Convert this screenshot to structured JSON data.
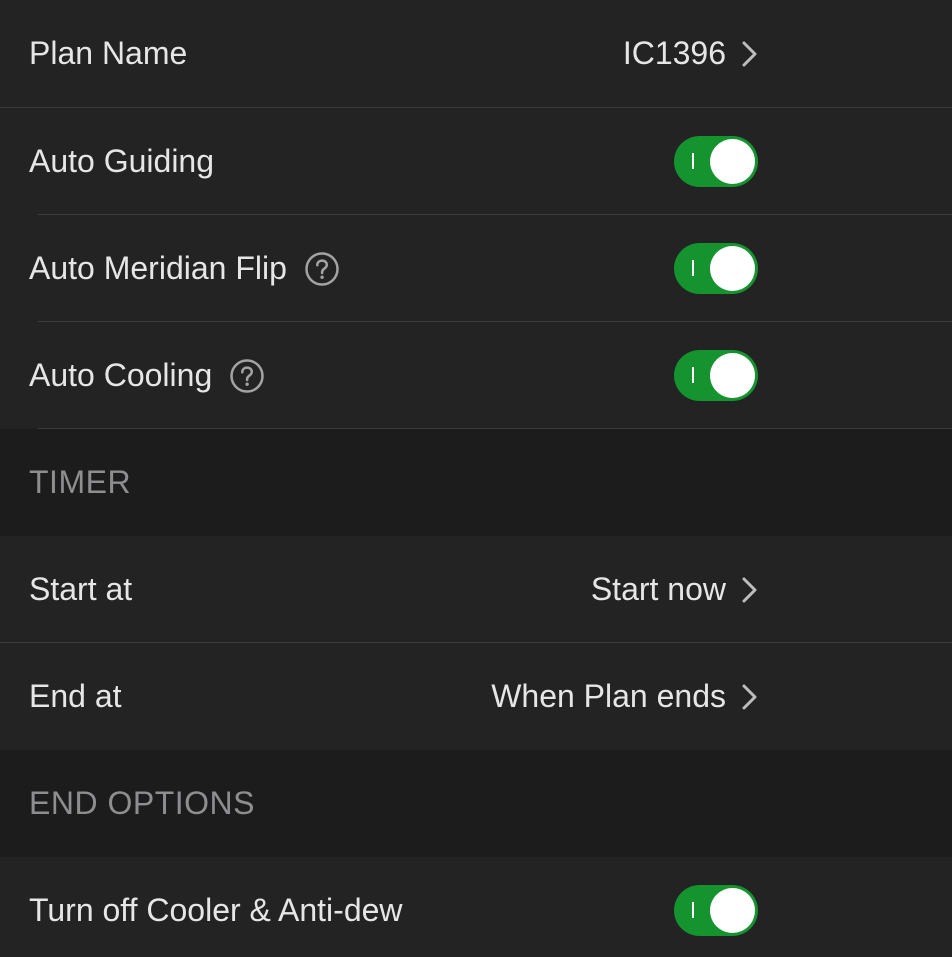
{
  "rows": {
    "plan_name": {
      "label": "Plan Name",
      "value": "IC1396",
      "chevron_icon": "chevron-right-icon"
    },
    "auto_guiding": {
      "label": "Auto Guiding",
      "toggle_on": true
    },
    "auto_meridian_flip": {
      "label": "Auto Meridian Flip",
      "help_icon": "question-circle-icon",
      "toggle_on": true
    },
    "auto_cooling": {
      "label": "Auto Cooling",
      "help_icon": "question-circle-icon",
      "toggle_on": true
    }
  },
  "timer_section": {
    "title": "TIMER",
    "start_at": {
      "label": "Start at",
      "value": "Start now",
      "chevron_icon": "chevron-right-icon"
    },
    "end_at": {
      "label": "End at",
      "value": "When Plan ends",
      "chevron_icon": "chevron-right-icon"
    }
  },
  "end_options_section": {
    "title": "END OPTIONS",
    "turn_off_cooler": {
      "label": "Turn off Cooler & Anti-dew",
      "toggle_on": true
    }
  },
  "colors": {
    "background": "#1c1c1d",
    "row_background": "#232324",
    "toggle_on": "#14932f",
    "text": "#e6e6e6",
    "section_text": "#8e8e91"
  }
}
